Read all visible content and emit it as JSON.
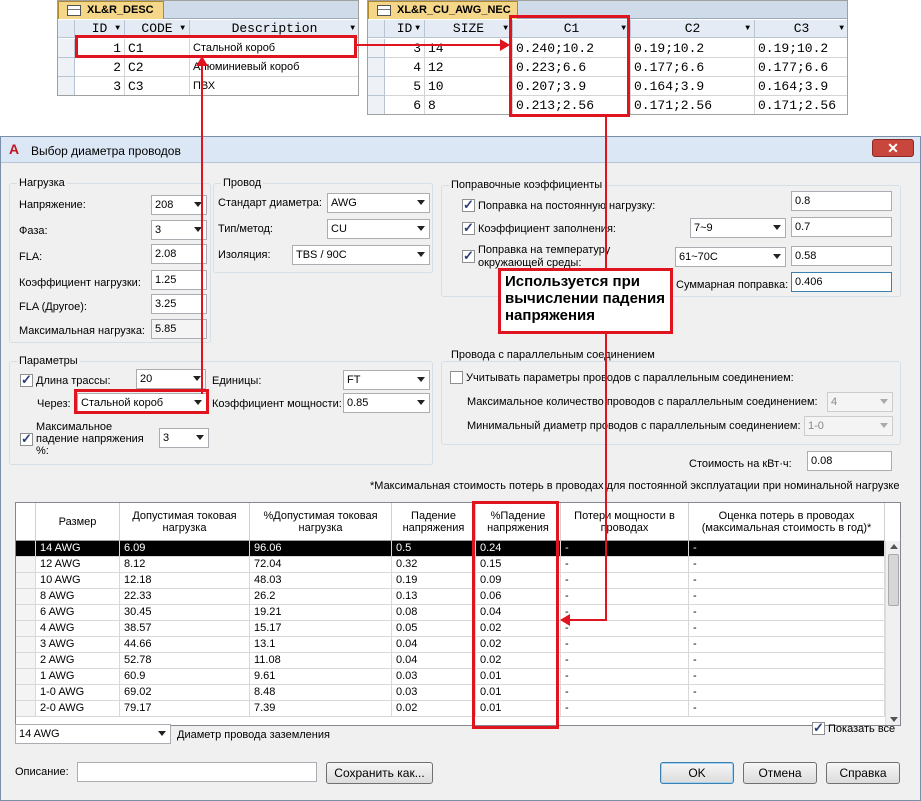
{
  "desc_table": {
    "tab": "XL&R_DESC",
    "headers": [
      "ID",
      "CODE",
      "Description"
    ],
    "rows": [
      {
        "id": "1",
        "code": "C1",
        "desc": "Стальной короб"
      },
      {
        "id": "2",
        "code": "C2",
        "desc": "Алюминиевый короб"
      },
      {
        "id": "3",
        "code": "C3",
        "desc": "ПВХ"
      }
    ]
  },
  "awg_table": {
    "tab": "XL&R_CU_AWG_NEC",
    "headers": [
      "ID",
      "SIZE",
      "C1",
      "C2",
      "C3"
    ],
    "rows": [
      {
        "id": "3",
        "size": "14",
        "c1": "0.240;10.2",
        "c2": "0.19;10.2",
        "c3": "0.19;10.2"
      },
      {
        "id": "4",
        "size": "12",
        "c1": "0.223;6.6",
        "c2": "0.177;6.6",
        "c3": "0.177;6.6"
      },
      {
        "id": "5",
        "size": "10",
        "c1": "0.207;3.9",
        "c2": "0.164;3.9",
        "c3": "0.164;3.9"
      },
      {
        "id": "6",
        "size": "8",
        "c1": "0.213;2.56",
        "c2": "0.171;2.56",
        "c3": "0.171;2.56"
      }
    ]
  },
  "dialog": {
    "title": "Выбор диаметра проводов",
    "close": "✕",
    "load": {
      "group": "Нагрузка",
      "voltage_label": "Напряжение:",
      "voltage": "208",
      "phase_label": "Фаза:",
      "phase": "3",
      "fla_label": "FLA:",
      "fla": "2.08",
      "load_factor_label": "Коэффициент нагрузки:",
      "load_factor": "1.25",
      "fla_other_label": "FLA (Другое):",
      "fla_other": "3.25",
      "max_load_label": "Максимальная нагрузка:",
      "max_load": "5.85"
    },
    "wire": {
      "group": "Провод",
      "standard_label": "Стандарт диаметра:",
      "standard": "AWG",
      "type_label": "Тип/метод:",
      "type": "CU",
      "insulation_label": "Изоляция:",
      "insulation": "TBS / 90C"
    },
    "correction": {
      "group": "Поправочные коэффициенты",
      "continuous_label": "Поправка на постоянную нагрузку:",
      "continuous": "0.8",
      "fill_label": "Коэффициент заполнения:",
      "fill_range": "7~9",
      "fill": "0.7",
      "temp_label": "Поправка на температуру окружающей среды:",
      "temp_range": "61~70C",
      "temp": "0.58",
      "total_label": "Суммарная поправка:",
      "total": "0.406"
    },
    "params": {
      "group": "Параметры",
      "length_label": "Длина трассы:",
      "length": "20",
      "units_label": "Единицы:",
      "units": "FT",
      "via_label": "Через:",
      "via": "Стальной короб",
      "pf_label": "Коэффициент мощности:",
      "pf": "0.85",
      "vdrop_label": "Максимальное падение напряжения %:",
      "vdrop": "3"
    },
    "parallel": {
      "group": "Провода с параллельным соединением",
      "consider_label": "Учитывать параметры проводов с параллельным соединением:",
      "max_label": "Максимальное количество проводов с параллельным соединением:",
      "max": "4",
      "min_label": "Минимальный диаметр проводов с параллельным соединением:",
      "min": "1-0"
    },
    "cost_label": "Стоимость на кВт·ч:",
    "cost": "0.08",
    "footnote": "*Максимальная стоимость потерь в проводах для постоянной эксплуатации при номинальной нагрузке",
    "grid": {
      "headers": [
        "Размер",
        "Допустимая токовая нагрузка",
        "%Допустимая токовая нагрузка",
        "Падение напряжения",
        "%Падение напряжения",
        "Потери мощности в проводах",
        "Оценка потерь в проводах (максимальная стоимость в год)*"
      ],
      "rows": [
        [
          "14 AWG",
          "6.09",
          "96.06",
          "0.5",
          "0.24",
          "-",
          "-"
        ],
        [
          "12 AWG",
          "8.12",
          "72.04",
          "0.32",
          "0.15",
          "-",
          "-"
        ],
        [
          "10 AWG",
          "12.18",
          "48.03",
          "0.19",
          "0.09",
          "-",
          "-"
        ],
        [
          "8 AWG",
          "22.33",
          "26.2",
          "0.13",
          "0.06",
          "-",
          "-"
        ],
        [
          "6 AWG",
          "30.45",
          "19.21",
          "0.08",
          "0.04",
          "-",
          "-"
        ],
        [
          "4 AWG",
          "38.57",
          "15.17",
          "0.05",
          "0.02",
          "-",
          "-"
        ],
        [
          "3 AWG",
          "44.66",
          "13.1",
          "0.04",
          "0.02",
          "-",
          "-"
        ],
        [
          "2 AWG",
          "52.78",
          "11.08",
          "0.04",
          "0.02",
          "-",
          "-"
        ],
        [
          "1 AWG",
          "60.9",
          "9.61",
          "0.03",
          "0.01",
          "-",
          "-"
        ],
        [
          "1-0 AWG",
          "69.02",
          "8.48",
          "0.03",
          "0.01",
          "-",
          "-"
        ],
        [
          "2-0 AWG",
          "79.17",
          "7.39",
          "0.02",
          "0.01",
          "-",
          "-"
        ]
      ]
    },
    "ground_size": "14 AWG",
    "ground_label": "Диаметр провода заземления",
    "show_all_label": "Показать все",
    "desc_label": "Описание:",
    "desc_value": "",
    "save_as": "Сохранить как...",
    "ok": "OK",
    "cancel": "Отмена",
    "help": "Справка"
  },
  "annotation": "Используется при вычислении падения напряжения",
  "colors": {
    "annotation": "#e0141e",
    "tab": "#f5d78a",
    "selected_row": "#000000"
  }
}
